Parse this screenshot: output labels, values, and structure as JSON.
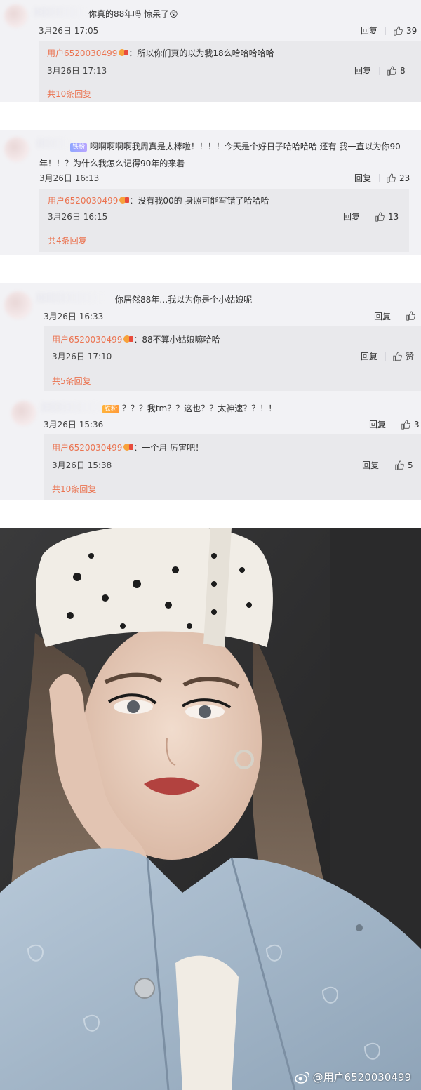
{
  "colors": {
    "accent": "#eb7350",
    "panel_bg": "#f2f2f5",
    "sub_bg": "#e9e9ec"
  },
  "comments": [
    {
      "text": "你真的88年吗 惊呆了😲",
      "date": "3月26日 17:05",
      "reply_label": "回复",
      "likes": "39",
      "sub": {
        "user": "用户6520030499",
        "text": "：所以你们真的以为我18么哈哈哈哈哈",
        "date": "3月26日 17:13",
        "reply_label": "回复",
        "likes": "8",
        "more": "共10条回复"
      }
    },
    {
      "badge": "铁粉",
      "text": "啊啊啊啊啊我周真是太棒啦！！！！今天是个好日子哈哈哈哈 还有 我一直以为你90年！！？为什么我怎么记得90年的来着",
      "date": "3月26日 16:13",
      "reply_label": "回复",
      "likes": "23",
      "sub": {
        "user": "用户6520030499",
        "text": "：没有我00的 身照可能写错了哈哈哈",
        "date": "3月26日 16:15",
        "reply_label": "回复",
        "likes": "13",
        "more": "共4条回复"
      }
    },
    {
      "text": "你居然88年…我以为你是个小姑娘呢",
      "date": "3月26日 16:33",
      "reply_label": "回复",
      "likes": "",
      "sub": {
        "user": "用户6520030499",
        "text": "：88不算小姑娘嘛哈哈",
        "date": "3月26日 17:10",
        "reply_label": "回复",
        "likes": "赞",
        "more": "共5条回复"
      }
    },
    {
      "badge": "铁粉",
      "text": "？？？我tm？？这也？？太神速？？！！",
      "date": "3月26日 15:36",
      "reply_label": "回复",
      "likes": "3",
      "sub": {
        "user": "用户6520030499",
        "text": "：一个月 厉害吧！",
        "date": "3月26日 15:38",
        "reply_label": "回复",
        "likes": "5",
        "more": "共10条回复"
      }
    }
  ],
  "photo": {
    "watermark": "@用户6520030499",
    "watermark_icon": "weibo-logo-icon"
  }
}
